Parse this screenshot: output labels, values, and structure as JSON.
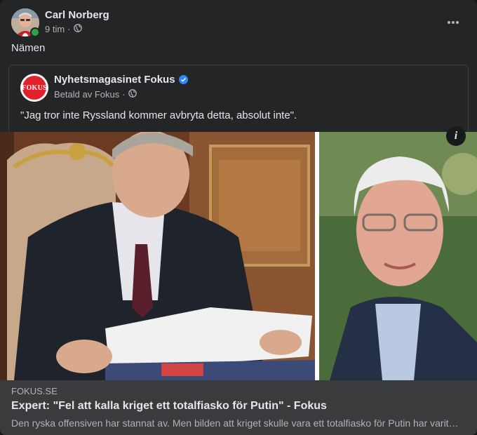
{
  "post": {
    "author": "Carl Norberg",
    "time": "9 tim",
    "separator": "·",
    "text": "Nämen",
    "privacy_icon": "globe-icon",
    "menu_icon": "more-horizontal-icon"
  },
  "shared_post": {
    "page_name": "Nyhetsmagasinet Fokus",
    "logo_text": "FOKUS",
    "verified_icon": "verified-badge-icon",
    "paid_by": "Betald av Fokus",
    "separator": "·",
    "quote": "\"Jag tror inte Ryssland kommer avbryta detta, absolut inte\"."
  },
  "media": {
    "info_label": "i"
  },
  "link_preview": {
    "domain": "FOKUS.SE",
    "title": "Expert: \"Fel att kalla kriget ett totalfiasko för Putin\" - Fokus",
    "description": "Den ryska offensiven har stannat av. Men bilden att kriget skulle vara ett totalfiasko för Putin har varit fel."
  },
  "colors": {
    "background": "#242526",
    "link_box": "#3a3b3c",
    "verified": "#2d88ff",
    "online": "#31a24c",
    "logo_red": "#e2202a"
  }
}
